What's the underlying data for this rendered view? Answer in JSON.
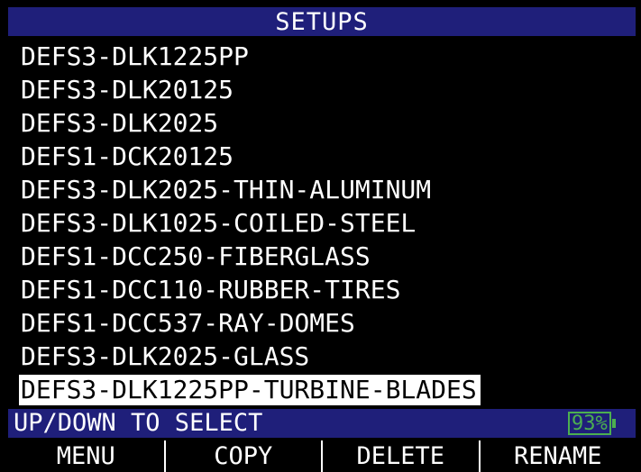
{
  "header": {
    "title": "SETUPS"
  },
  "setups": [
    "DEFS3-DLK1225PP",
    "DEFS3-DLK20125",
    "DEFS3-DLK2025",
    "DEFS1-DCK20125",
    "DEFS3-DLK2025-THIN-ALUMINUM",
    "DEFS3-DLK1025-COILED-STEEL",
    "DEFS1-DCC250-FIBERGLASS",
    "DEFS1-DCC110-RUBBER-TIRES",
    "DEFS1-DCC537-RAY-DOMES",
    "DEFS3-DLK2025-GLASS",
    "DEFS3-DLK1225PP-TURBINE-BLADES"
  ],
  "selected_index": 10,
  "status": {
    "text": "UP/DOWN TO SELECT",
    "battery": "93%"
  },
  "softkeys": {
    "menu": "MENU",
    "copy": "COPY",
    "delete": "DELETE",
    "rename": "RENAME"
  },
  "colors": {
    "bar": "#1f1f7a",
    "battery": "#4caf50",
    "selection": "#ffffff"
  }
}
